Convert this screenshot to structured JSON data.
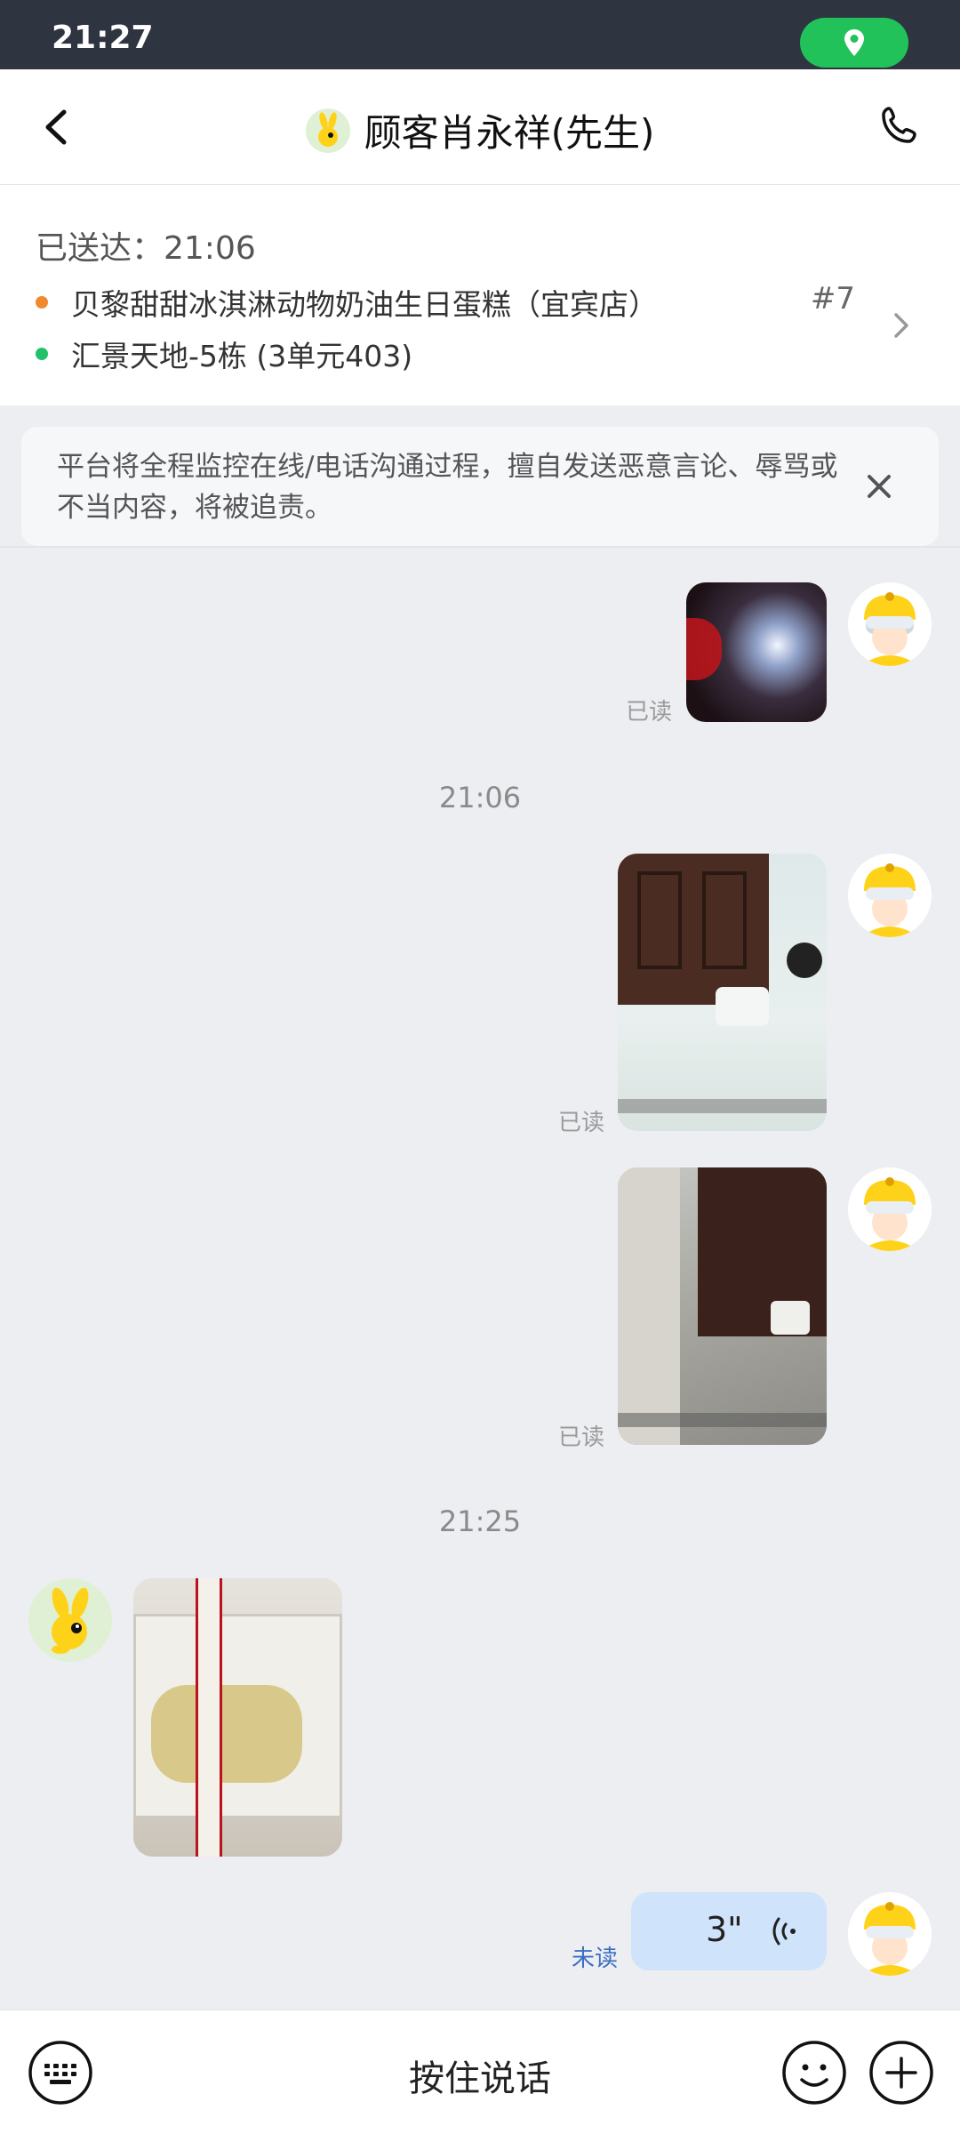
{
  "status_bar": {
    "time": "21:27"
  },
  "header": {
    "title": "顾客肖永祥(先生)"
  },
  "order": {
    "delivered_label": "已送达：21:06",
    "store": "贝黎甜甜冰淇淋动物奶油生日蛋糕（宜宾店）",
    "address": "汇景天地-5栋 (3单元403)",
    "order_no": "#7",
    "store_dot_color": "#f08a2c",
    "address_dot_color": "#22c06a"
  },
  "notice": {
    "text": "平台将全程监控在线/电话沟通过程，擅自发送恶意言论、辱骂或不当内容，将被追责。"
  },
  "messages": {
    "read_label": "已读",
    "unread_label": "未读",
    "time_1": "21:06",
    "time_2": "21:25",
    "voice_duration": "3\""
  },
  "bottom_bar": {
    "hold_to_talk": "按住说话"
  },
  "colors": {
    "accent_green": "#21c25a",
    "status_bar": "#2f3441",
    "voice_bubble": "#cfe3fb",
    "unread_blue": "#3b6fc4"
  }
}
